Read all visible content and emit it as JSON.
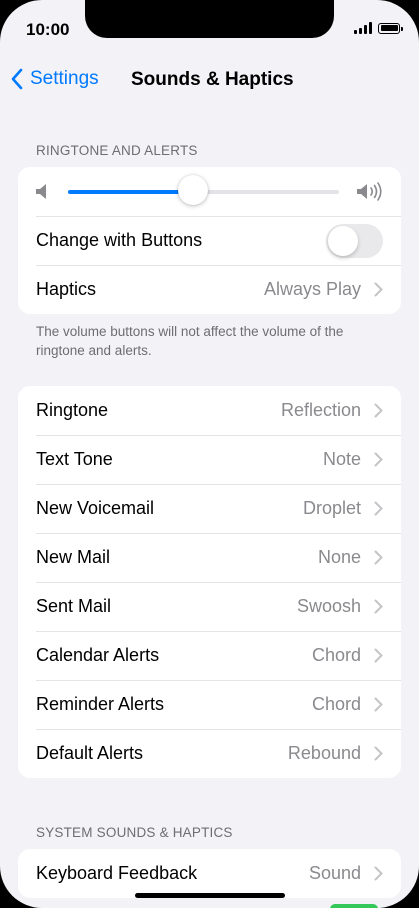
{
  "status_bar": {
    "time": "10:00"
  },
  "nav": {
    "back_label": "Settings",
    "title": "Sounds & Haptics"
  },
  "ringtone_section": {
    "header": "RINGTONE AND ALERTS",
    "volume_level": 0.46,
    "change_with_buttons_label": "Change with Buttons",
    "change_with_buttons_on": false,
    "haptics_label": "Haptics",
    "haptics_value": "Always Play",
    "footnote": "The volume buttons will not affect the volume of the ringtone and alerts."
  },
  "sounds_list": [
    {
      "label": "Ringtone",
      "value": "Reflection"
    },
    {
      "label": "Text Tone",
      "value": "Note"
    },
    {
      "label": "New Voicemail",
      "value": "Droplet"
    },
    {
      "label": "New Mail",
      "value": "None"
    },
    {
      "label": "Sent Mail",
      "value": "Swoosh"
    },
    {
      "label": "Calendar Alerts",
      "value": "Chord"
    },
    {
      "label": "Reminder Alerts",
      "value": "Chord"
    },
    {
      "label": "Default Alerts",
      "value": "Rebound"
    }
  ],
  "system_section": {
    "header": "SYSTEM SOUNDS & HAPTICS",
    "keyboard_feedback_label": "Keyboard Feedback",
    "keyboard_feedback_value": "Sound"
  },
  "colors": {
    "accent": "#007aff",
    "background": "#f2f2f7",
    "secondary_text": "#8a8a8e",
    "toggle_on": "#34c759"
  }
}
